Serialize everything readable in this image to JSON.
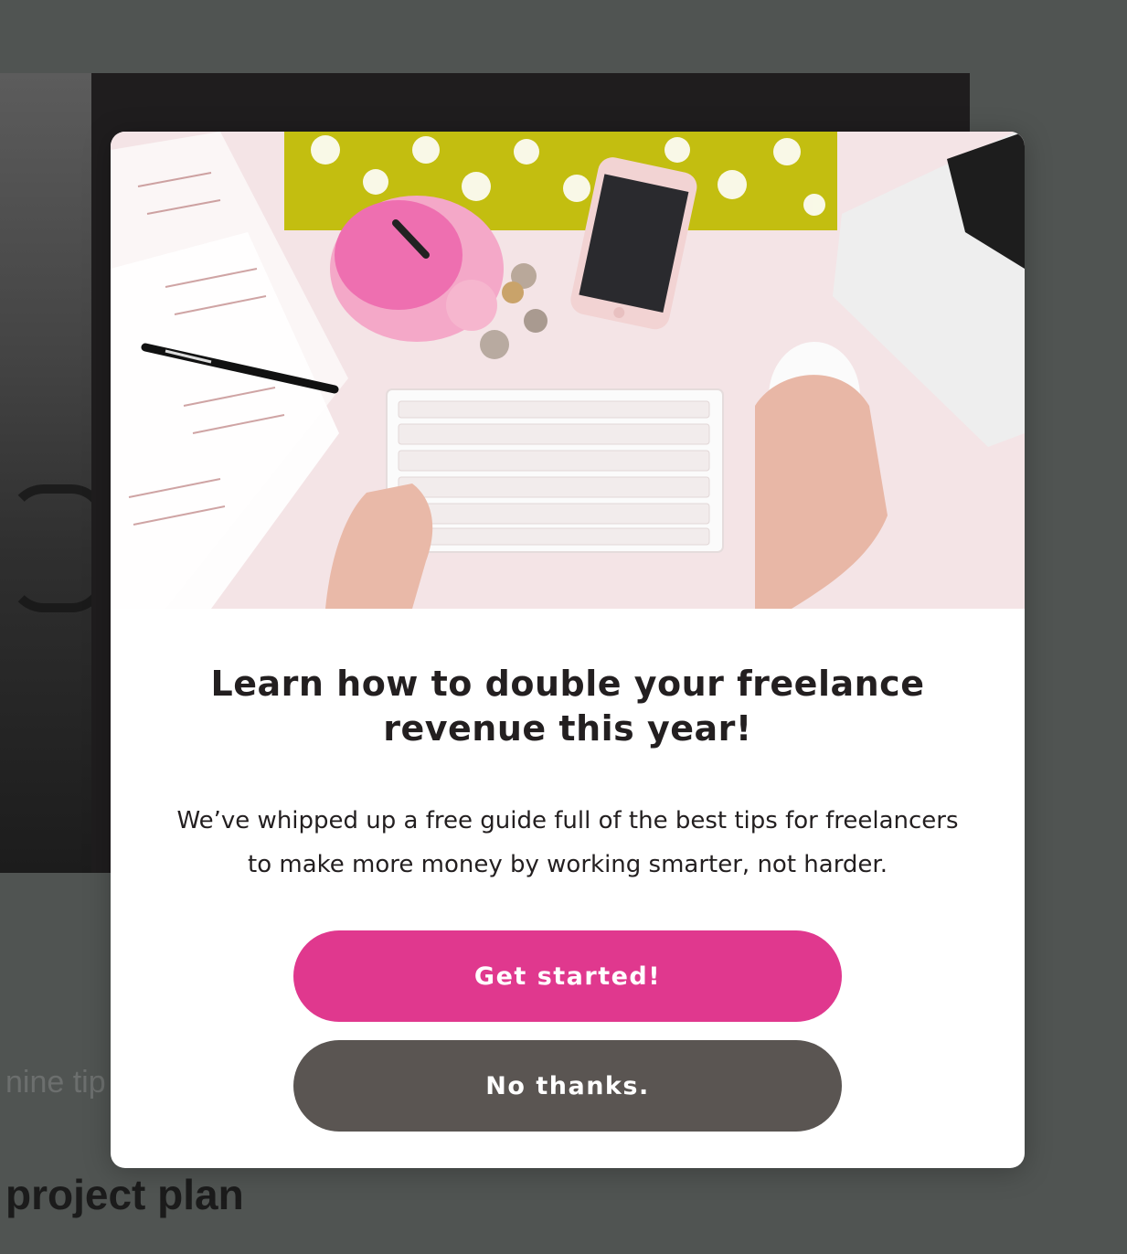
{
  "background_page": {
    "snippet_text": "nine tip",
    "heading_text": "project plan"
  },
  "popup": {
    "image_description": "Overhead desk photo: pink piggy bank, smartphone, coins, white keyboard, mouse, laptop and handwritten notes on a pink desk",
    "title": "Learn how to double your freelance revenue this year!",
    "body": "We’ve whipped up a free guide full of the best tips for freelancers to make more money by working smarter, not harder.",
    "primary_button_label": "Get started!",
    "secondary_button_label": "No thanks."
  },
  "colors": {
    "overlay": "#505452",
    "primary_button": "#e0388e",
    "secondary_button": "#5a5552",
    "text": "#231f20"
  }
}
